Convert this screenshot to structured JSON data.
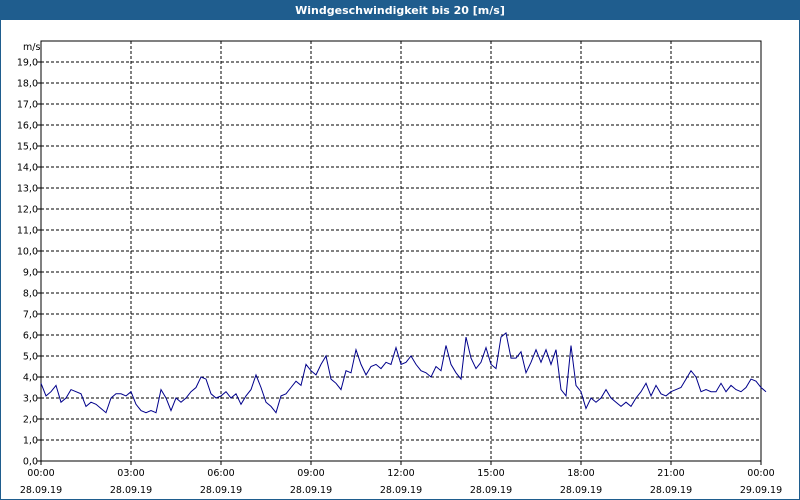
{
  "window": {
    "title": "Windgeschwindigkeit bis 20 [m/s]"
  },
  "chart_data": {
    "type": "line",
    "title": "Windgeschwindigkeit bis 20 [m/s]",
    "ylabel": "m/s",
    "ylim": [
      0,
      20
    ],
    "xlim_hours": [
      0,
      24
    ],
    "grid": true,
    "y_ticks": [
      "0,0",
      "1,0",
      "2,0",
      "3,0",
      "4,0",
      "5,0",
      "6,0",
      "7,0",
      "8,0",
      "9,0",
      "10,0",
      "11,0",
      "12,0",
      "13,0",
      "14,0",
      "15,0",
      "16,0",
      "17,0",
      "18,0",
      "19,0"
    ],
    "x_ticks": [
      {
        "time": "00:00",
        "date": "28.09.19"
      },
      {
        "time": "03:00",
        "date": "28.09.19"
      },
      {
        "time": "06:00",
        "date": "28.09.19"
      },
      {
        "time": "09:00",
        "date": "28.09.19"
      },
      {
        "time": "12:00",
        "date": "28.09.19"
      },
      {
        "time": "15:00",
        "date": "28.09.19"
      },
      {
        "time": "18:00",
        "date": "28.09.19"
      },
      {
        "time": "21:00",
        "date": "28.09.19"
      },
      {
        "time": "00:00",
        "date": "29.09.19"
      }
    ],
    "series": [
      {
        "color": "#00008b",
        "interval_minutes": 10,
        "values": [
          3.7,
          3.1,
          3.3,
          3.6,
          2.8,
          3.0,
          3.4,
          3.3,
          3.2,
          2.6,
          2.8,
          2.7,
          2.5,
          2.3,
          3.0,
          3.2,
          3.2,
          3.1,
          3.3,
          2.7,
          2.4,
          2.3,
          2.4,
          2.3,
          3.4,
          3.0,
          2.4,
          3.0,
          2.8,
          3.0,
          3.3,
          3.5,
          4.0,
          3.9,
          3.2,
          3.0,
          3.1,
          3.3,
          3.0,
          3.2,
          2.7,
          3.1,
          3.4,
          4.1,
          3.5,
          2.8,
          2.6,
          2.3,
          3.1,
          3.2,
          3.5,
          3.8,
          3.6,
          4.6,
          4.3,
          4.1,
          4.6,
          5.0,
          3.9,
          3.7,
          3.4,
          4.3,
          4.2,
          5.3,
          4.6,
          4.1,
          4.5,
          4.6,
          4.4,
          4.7,
          4.6,
          5.4,
          4.6,
          4.7,
          5.0,
          4.6,
          4.3,
          4.2,
          4.0,
          4.5,
          4.3,
          5.5,
          4.6,
          4.2,
          3.9,
          5.9,
          4.9,
          4.4,
          4.7,
          5.4,
          4.6,
          4.4,
          5.9,
          6.1,
          4.9,
          4.9,
          5.2,
          4.2,
          4.7,
          5.3,
          4.7,
          5.3,
          4.6,
          5.3,
          3.4,
          3.1,
          5.5,
          3.6,
          3.3,
          2.5,
          3.0,
          2.8,
          3.0,
          3.4,
          3.0,
          2.8,
          2.6,
          2.8,
          2.6,
          3.0,
          3.3,
          3.7,
          3.1,
          3.6,
          3.2,
          3.1,
          3.3,
          3.4,
          3.5,
          3.9,
          4.3,
          4.0,
          3.3,
          3.4,
          3.3,
          3.3,
          3.7,
          3.3,
          3.6,
          3.4,
          3.3,
          3.5,
          3.9,
          3.8,
          3.5,
          3.3
        ]
      }
    ]
  }
}
